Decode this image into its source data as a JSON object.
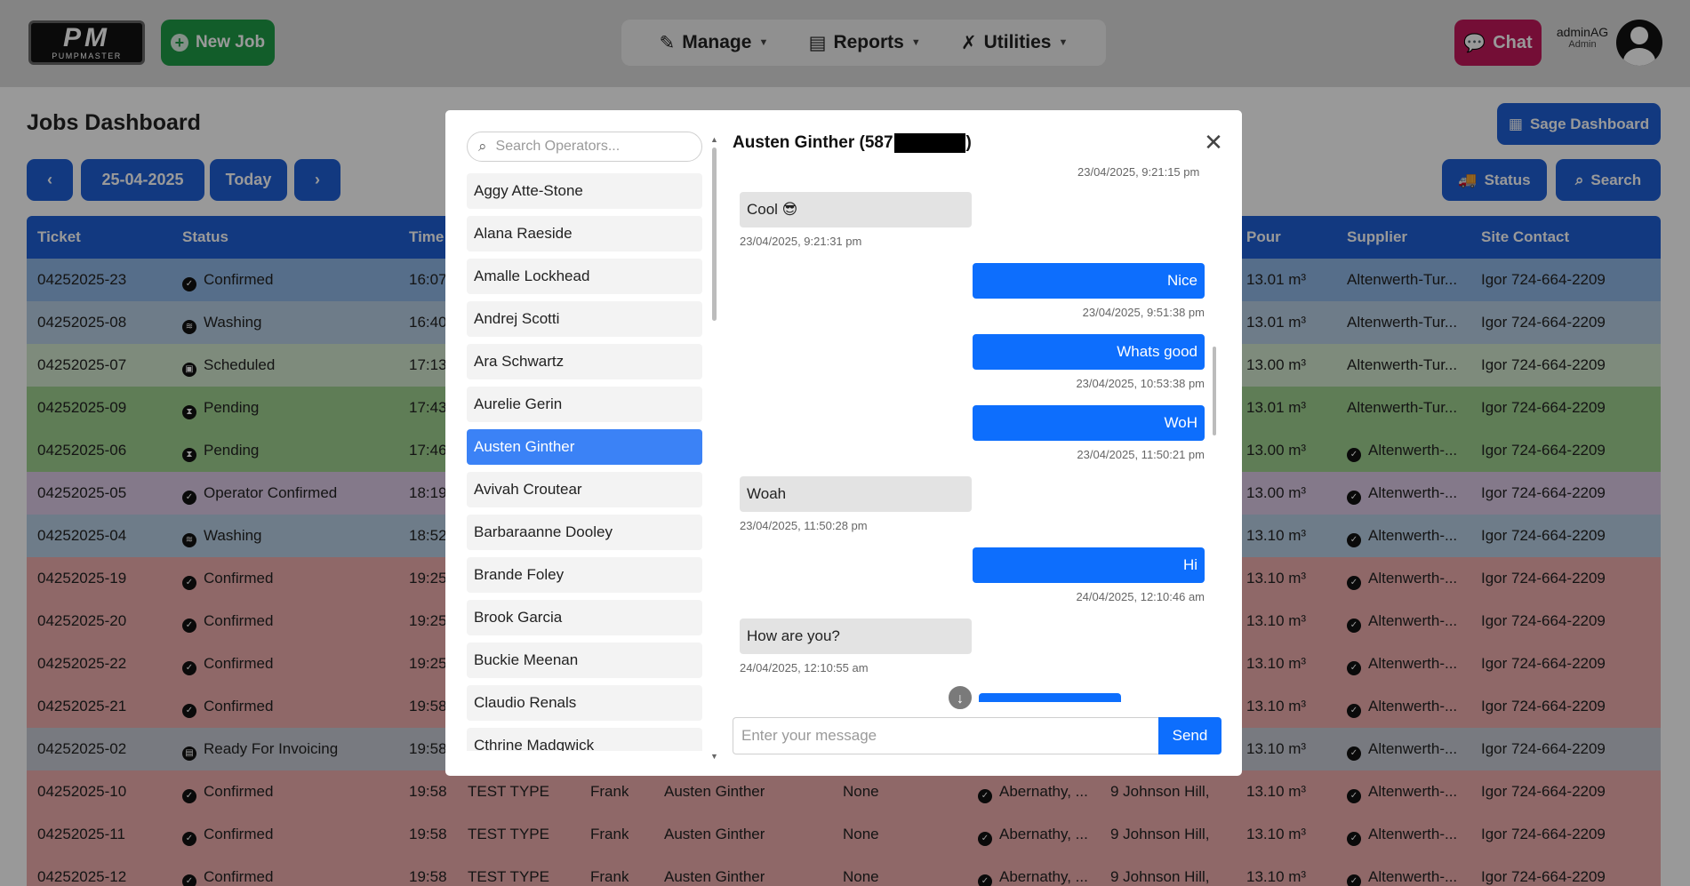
{
  "navbar": {
    "logo_text": "PM",
    "logo_sub": "PUMPMASTER",
    "new_job_label": "New Job",
    "menu": [
      {
        "label": "Manage",
        "icon": "edit-icon"
      },
      {
        "label": "Reports",
        "icon": "document-icon"
      },
      {
        "label": "Utilities",
        "icon": "tools-icon"
      }
    ],
    "chat_label": "Chat",
    "user_name": "adminAG",
    "user_role": "Admin"
  },
  "dashboard": {
    "title": "Jobs Dashboard",
    "sage_label": "Sage Dashboard",
    "prev_label": "‹",
    "date_label": "25-04-2025",
    "today_label": "Today",
    "next_label": "›",
    "status_label": "Status",
    "search_label": "Search"
  },
  "table": {
    "headers": [
      "Ticket",
      "Status",
      "Time",
      "",
      "",
      "",
      "",
      "",
      "",
      "Pour",
      "Supplier",
      "Site Contact"
    ],
    "rows": [
      {
        "ticket": "04252025-23",
        "status": "Confirmed",
        "time": "16:07",
        "pour": "13.01 m³",
        "supplier": "Altenwerth-Tur...",
        "contact": "Igor 724-664-2209",
        "color": "#8fb7e6"
      },
      {
        "ticket": "04252025-08",
        "status": "Washing",
        "time": "16:40",
        "pour": "13.01 m³",
        "supplier": "Altenwerth-Tur...",
        "contact": "Igor 724-664-2209",
        "color": "#b8cfe4"
      },
      {
        "ticket": "04252025-07",
        "status": "Scheduled",
        "time": "17:13",
        "pour": "13.00 m³",
        "supplier": "Altenwerth-Tur...",
        "contact": "Igor 724-664-2209",
        "color": "#d3e8cf"
      },
      {
        "ticket": "04252025-09",
        "status": "Pending",
        "time": "17:43",
        "pour": "13.01 m³",
        "supplier": "Altenwerth-Tur...",
        "contact": "Igor 724-664-2209",
        "color": "#9fd08f"
      },
      {
        "ticket": "04252025-06",
        "status": "Pending",
        "time": "17:46",
        "pour": "13.00 m³",
        "supplier": "Altenwerth-...",
        "contact": "Igor 724-664-2209",
        "color": "#9fd08f"
      },
      {
        "ticket": "04252025-05",
        "status": "Operator Confirmed",
        "time": "18:19",
        "pour": "13.00 m³",
        "supplier": "Altenwerth-...",
        "contact": "Igor 724-664-2209",
        "color": "#dccae6"
      },
      {
        "ticket": "04252025-04",
        "status": "Washing",
        "time": "18:52",
        "pour": "13.10 m³",
        "supplier": "Altenwerth-...",
        "contact": "Igor 724-664-2209",
        "color": "#b8cfe4"
      },
      {
        "ticket": "04252025-19",
        "status": "Confirmed",
        "time": "19:25",
        "pour": "13.10 m³",
        "supplier": "Altenwerth-...",
        "contact": "Igor 724-664-2209",
        "color": "#efaeae"
      },
      {
        "ticket": "04252025-20",
        "status": "Confirmed",
        "time": "19:25",
        "pour": "13.10 m³",
        "supplier": "Altenwerth-...",
        "contact": "Igor 724-664-2209",
        "color": "#efaeae"
      },
      {
        "ticket": "04252025-22",
        "status": "Confirmed",
        "time": "19:25",
        "pour": "13.10 m³",
        "supplier": "Altenwerth-...",
        "contact": "Igor 724-664-2209",
        "color": "#efaeae"
      },
      {
        "ticket": "04252025-21",
        "status": "Confirmed",
        "time": "19:58",
        "pour": "13.10 m³",
        "supplier": "Altenwerth-...",
        "contact": "Igor 724-664-2209",
        "color": "#efaeae"
      },
      {
        "ticket": "04252025-02",
        "status": "Ready For Invoicing",
        "time": "19:58",
        "pour": "13.10 m³",
        "supplier": "Altenwerth-...",
        "contact": "Igor 724-664-2209",
        "color": "#c9ccd6"
      },
      {
        "ticket": "04252025-10",
        "status": "Confirmed",
        "time": "19:58",
        "type": "TEST TYPE",
        "op": "Frank",
        "driver": "Austen Ginther",
        "none": "None",
        "client": "Abernathy, ...",
        "site": "9 Johnson Hill,",
        "pour": "13.10 m³",
        "supplier": "Altenwerth-...",
        "contact": "Igor 724-664-2209",
        "color": "#efaeae"
      },
      {
        "ticket": "04252025-11",
        "status": "Confirmed",
        "time": "19:58",
        "type": "TEST TYPE",
        "op": "Frank",
        "driver": "Austen Ginther",
        "none": "None",
        "client": "Abernathy, ...",
        "site": "9 Johnson Hill,",
        "pour": "13.10 m³",
        "supplier": "Altenwerth-...",
        "contact": "Igor 724-664-2209",
        "color": "#efaeae"
      },
      {
        "ticket": "04252025-12",
        "status": "Confirmed",
        "time": "19:58",
        "type": "TEST TYPE",
        "op": "Frank",
        "driver": "Austen Ginther",
        "none": "None",
        "client": "Abernathy, ...",
        "site": "9 Johnson Hill,",
        "pour": "13.10 m³",
        "supplier": "Altenwerth-...",
        "contact": "Igor 724-664-2209",
        "color": "#efaeae"
      }
    ]
  },
  "chat_modal": {
    "search_placeholder": "Search Operators...",
    "operators": [
      "Aggy Atte-Stone",
      "Alana Raeside",
      "Amalle Lockhead",
      "Andrej Scotti",
      "Ara Schwartz",
      "Aurelie Gerin",
      "Austen Ginther",
      "Avivah Croutear",
      "Barbaraanne Dooley",
      "Brande Foley",
      "Brook Garcia",
      "Buckie Meenan",
      "Claudio Renals",
      "Cthrine Madgwick"
    ],
    "active_operator": "Austen Ginther",
    "title_prefix": "Austen Ginther (587",
    "title_suffix": ")",
    "close_label": "✕",
    "top_partial_ts": "23/04/2025, 9:21:15 pm",
    "messages": [
      {
        "dir": "in",
        "text": "Cool 😎",
        "ts": "23/04/2025, 9:21:31 pm"
      },
      {
        "dir": "out",
        "text": "Nice",
        "ts": "23/04/2025, 9:51:38 pm"
      },
      {
        "dir": "out",
        "text": "Whats good",
        "ts": "23/04/2025, 10:53:38 pm"
      },
      {
        "dir": "out",
        "text": "WoH",
        "ts": "23/04/2025, 11:50:21 pm"
      },
      {
        "dir": "in",
        "text": "Woah",
        "ts": "23/04/2025, 11:50:28 pm"
      },
      {
        "dir": "out",
        "text": "Hi",
        "ts": "24/04/2025, 12:10:46 am"
      },
      {
        "dir": "in",
        "text": "How are you?",
        "ts": "24/04/2025, 12:10:55 am"
      }
    ],
    "input_placeholder": "Enter your message",
    "send_label": "Send"
  }
}
